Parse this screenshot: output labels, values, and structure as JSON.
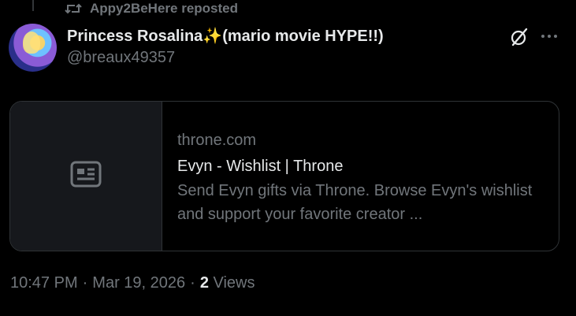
{
  "repost": {
    "label": "Appy2BeHere reposted"
  },
  "author": {
    "display_name": "Princess Rosalina✨(mario movie HYPE!!)",
    "handle": "@breaux49357"
  },
  "card": {
    "domain": "throne.com",
    "title": "Evyn - Wishlist | Throne",
    "description": "Send Evyn gifts via Throne. Browse Evyn's wishlist and support your favorite creator ..."
  },
  "meta": {
    "time": "10:47 PM",
    "sep1": "·",
    "date": "Mar 19, 2026",
    "sep2": "·",
    "views_count": "2",
    "views_label": "Views"
  },
  "colors": {
    "background": "#000000",
    "primary_text": "#e7e9ea",
    "secondary_text": "#71767b",
    "border": "#2f3336"
  },
  "icons": [
    "repost-icon",
    "grok-icon",
    "more-icon",
    "article-icon"
  ]
}
